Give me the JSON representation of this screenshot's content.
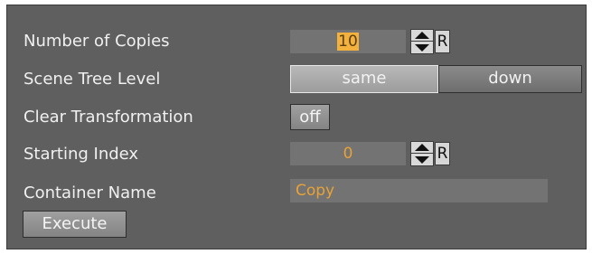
{
  "form": {
    "copies": {
      "label": "Number of Copies",
      "value_highlighted": "10",
      "reset_label": "R"
    },
    "scene_tree": {
      "label": "Scene Tree Level",
      "options": [
        "same",
        "down"
      ],
      "selected": "same"
    },
    "clear_transformation": {
      "label": "Clear Transformation",
      "value": "off"
    },
    "starting_index": {
      "label": "Starting Index",
      "value": "0",
      "reset_label": "R"
    },
    "container_name": {
      "label": "Container Name",
      "value": "Copy"
    },
    "execute_label": "Execute"
  },
  "colors": {
    "panel": "#5f5f5f",
    "field": "#737373",
    "value_text": "#e8a235",
    "label_text": "#f0f0f0"
  }
}
